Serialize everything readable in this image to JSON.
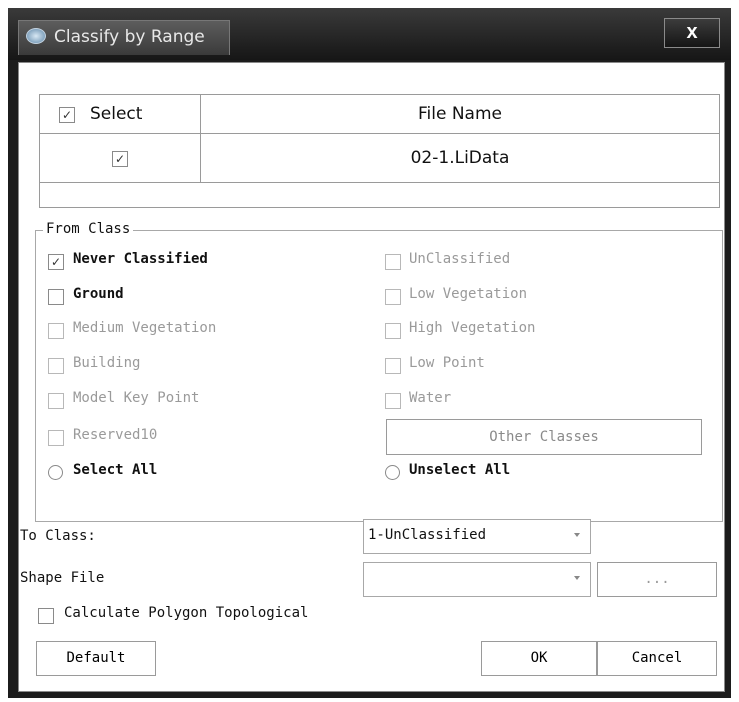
{
  "window": {
    "title": "Classify by Range",
    "close_label": "x"
  },
  "file_table": {
    "headers": {
      "select": "Select",
      "file_name": "File Name"
    },
    "select_all_checked": "✓",
    "rows": [
      {
        "checked": "✓",
        "file_name": "02-1.LiData"
      }
    ]
  },
  "from_class": {
    "legend": "From Class",
    "left": [
      {
        "label": "Never Classified",
        "checked": "✓"
      },
      {
        "label": "Ground"
      },
      {
        "label": "Medium Vegetation"
      },
      {
        "label": "Building"
      },
      {
        "label": "Model Key Point"
      },
      {
        "label": "Reserved10"
      }
    ],
    "right": [
      {
        "label": "UnClassified"
      },
      {
        "label": "Low Vegetation"
      },
      {
        "label": "High Vegetation"
      },
      {
        "label": "Low Point"
      },
      {
        "label": "Water"
      }
    ],
    "other_classes_label": "Other Classes",
    "select_all_label": "Select All",
    "unselect_all_label": "Unselect All"
  },
  "to_class": {
    "label": "To Class:",
    "value": "1-UnClassified"
  },
  "shape_file": {
    "label": "Shape File",
    "value": "",
    "browse_label": "..."
  },
  "calc_polygon": {
    "label": "Calculate Polygon Topological"
  },
  "buttons": {
    "default": "Default",
    "ok": "OK",
    "cancel": "Cancel"
  }
}
